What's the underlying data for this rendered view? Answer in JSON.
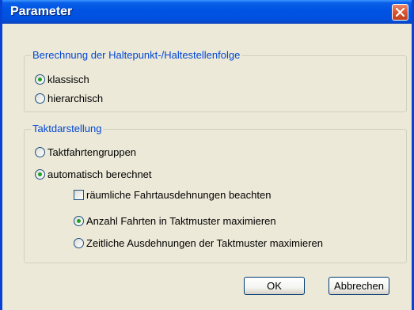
{
  "window": {
    "title": "Parameter"
  },
  "group1": {
    "title": "Berechnung der Haltepunkt-/Haltestellenfolge",
    "options": [
      {
        "label": "klassisch",
        "checked": true
      },
      {
        "label": "hierarchisch",
        "checked": false
      }
    ]
  },
  "group2": {
    "title": "Taktdarstellung",
    "options": [
      {
        "label": "Taktfahrtengruppen",
        "checked": false
      },
      {
        "label": "automatisch berechnet",
        "checked": true
      }
    ],
    "checkbox": {
      "label": "räumliche Fahrtausdehnungen beachten",
      "checked": false
    },
    "sub_options": [
      {
        "label": "Anzahl Fahrten in Taktmuster maximieren",
        "checked": true
      },
      {
        "label": "Zeitliche Ausdehnungen der Taktmuster maximieren",
        "checked": false
      }
    ]
  },
  "buttons": {
    "ok": "OK",
    "cancel": "Abbrechen"
  }
}
